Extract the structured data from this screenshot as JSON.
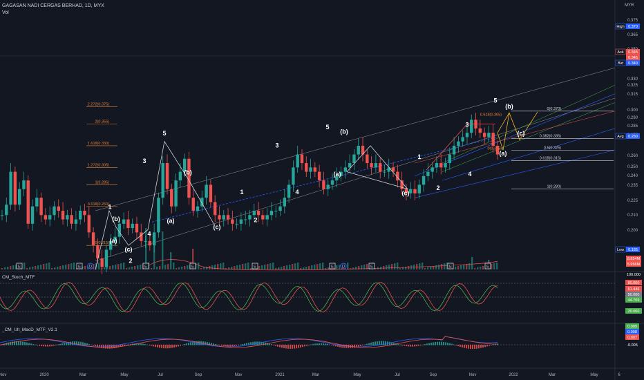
{
  "header": {
    "title": "GAGASAN NADI CERGAS BERHAD, 1D, MYX",
    "vol_label": "Vol",
    "corner_label": "MYR"
  },
  "indicators": {
    "stoch": {
      "name": "CM_Stoch_MTF",
      "levels": [
        "100.000",
        "80.000",
        "61.446",
        "50.000",
        "44.709",
        "20.000"
      ],
      "colors": [
        "#ef5350",
        "#4caf50"
      ]
    },
    "macd": {
      "name": "_CM_Ult_MacD_MTF_V2.1",
      "levels": [
        "0.009",
        "0.008",
        "0.007",
        "-0.005"
      ]
    }
  },
  "price_axis": {
    "ticks": [
      "0.375",
      "0.365",
      "0.350",
      "0.340",
      "0.330",
      "0.325",
      "0.315",
      "0.300",
      "0.290",
      "0.285",
      "0.275",
      "0.260",
      "0.250",
      "0.240",
      "0.235",
      "0.225",
      "0.210",
      "0.200"
    ],
    "badges": [
      {
        "label": "High",
        "value": "0.370",
        "color": "#2962ff"
      },
      {
        "label": "Ask",
        "value": "0.345",
        "color": "#ef5350"
      },
      {
        "label": "",
        "value": "0.345",
        "color": "#ef5350"
      },
      {
        "label": "Bid",
        "value": "0.340",
        "color": "#2962ff"
      },
      {
        "label": "Avg",
        "value": "0.280",
        "color": "#2962ff"
      },
      {
        "label": "Low",
        "value": "0.185",
        "color": "#2962ff"
      }
    ],
    "vol_badges": [
      {
        "value": "8.854M",
        "color": "#ef5350"
      },
      {
        "value": "5.956M",
        "color": "#ef5350"
      }
    ]
  },
  "time_axis": [
    "Nov",
    "2020",
    "Mar",
    "May",
    "Jul",
    "Sep",
    "Nov",
    "2021",
    "Mar",
    "May",
    "Jul",
    "Sep",
    "Nov",
    "2022",
    "Mar",
    "May",
    "6"
  ],
  "fib_left": [
    {
      "label": "2.272(0.375)",
      "price": 0.375
    },
    {
      "label": "2(0.355)",
      "price": 0.355
    },
    {
      "label": "1.618(0.330)",
      "price": 0.33
    },
    {
      "label": "1.272(0.305)",
      "price": 0.305
    },
    {
      "label": "1(0.285)",
      "price": 0.285
    },
    {
      "label": "0.618(0.260)",
      "price": 0.26
    },
    {
      "label": "0(0.215)",
      "price": 0.215
    }
  ],
  "fib_right": [
    {
      "label": "0(0.370)",
      "price": 0.37
    },
    {
      "label": "0.382(0.335)",
      "price": 0.3385
    },
    {
      "label": "0.5(0.325)",
      "price": 0.325
    },
    {
      "label": "0.618(0.315)",
      "price": 0.313
    },
    {
      "label": "1(0.280)",
      "price": 0.28
    }
  ],
  "fib_small": [
    {
      "label": "0.618(0.365)",
      "price": 0.364
    },
    {
      "label": "0(0.325)",
      "price": 0.325
    }
  ],
  "wave_labels": [
    {
      "text": "1",
      "x": 159,
      "price": 0.257
    },
    {
      "text": "(b)",
      "x": 168,
      "price": 0.243
    },
    {
      "text": "(a)",
      "x": 164,
      "price": 0.218
    },
    {
      "text": "(c)",
      "x": 186,
      "price": 0.208
    },
    {
      "text": "2",
      "x": 189,
      "price": 0.195
    },
    {
      "text": "3",
      "x": 209,
      "price": 0.31
    },
    {
      "text": "4",
      "x": 216,
      "price": 0.226
    },
    {
      "text": "5",
      "x": 238,
      "price": 0.342
    },
    {
      "text": "(b)",
      "x": 272,
      "price": 0.297
    },
    {
      "text": "(a)",
      "x": 247,
      "price": 0.241
    },
    {
      "text": "(c)",
      "x": 314,
      "price": 0.234
    },
    {
      "text": "1",
      "x": 350,
      "price": 0.274
    },
    {
      "text": "2",
      "x": 370,
      "price": 0.242
    },
    {
      "text": "3",
      "x": 401,
      "price": 0.328
    },
    {
      "text": "4",
      "x": 430,
      "price": 0.274
    },
    {
      "text": "5",
      "x": 474,
      "price": 0.349
    },
    {
      "text": "(b)",
      "x": 498,
      "price": 0.344
    },
    {
      "text": "(a)",
      "x": 488,
      "price": 0.295
    },
    {
      "text": "(c)",
      "x": 587,
      "price": 0.273
    },
    {
      "text": "1",
      "x": 607,
      "price": 0.315
    },
    {
      "text": "2",
      "x": 634,
      "price": 0.279
    },
    {
      "text": "3",
      "x": 676,
      "price": 0.352
    },
    {
      "text": "4",
      "x": 680,
      "price": 0.295
    },
    {
      "text": "5",
      "x": 717,
      "price": 0.38
    },
    {
      "text": "(b)",
      "x": 737,
      "price": 0.373
    },
    {
      "text": "(c)",
      "x": 754,
      "price": 0.342
    },
    {
      "text": "(a)",
      "x": 728,
      "price": 0.319
    }
  ],
  "earnings_markers": [
    "E",
    "E",
    "D",
    "E",
    "E",
    "E",
    "E",
    "D",
    "E",
    "E",
    "E"
  ],
  "chart_data": {
    "type": "candlestick",
    "ylim": [
      0.185,
      0.38
    ],
    "close": [
      0.25,
      0.262,
      0.3,
      0.262,
      0.28,
      0.29,
      0.24,
      0.26,
      0.27,
      0.25,
      0.245,
      0.25,
      0.26,
      0.255,
      0.245,
      0.25,
      0.24,
      0.245,
      0.255,
      0.25,
      0.23,
      0.215,
      0.2,
      0.19,
      0.21,
      0.22,
      0.225,
      0.24,
      0.245,
      0.235,
      0.24,
      0.23,
      0.22,
      0.22,
      0.215,
      0.23,
      0.27,
      0.31,
      0.28,
      0.26,
      0.29,
      0.3,
      0.315,
      0.27,
      0.255,
      0.26,
      0.27,
      0.285,
      0.265,
      0.25,
      0.245,
      0.25,
      0.245,
      0.24,
      0.24,
      0.245,
      0.245,
      0.25,
      0.255,
      0.25,
      0.245,
      0.25,
      0.255,
      0.255,
      0.26,
      0.27,
      0.285,
      0.305,
      0.32,
      0.31,
      0.3,
      0.305,
      0.3,
      0.29,
      0.28,
      0.285,
      0.29,
      0.295,
      0.3,
      0.305,
      0.31,
      0.32,
      0.33,
      0.32,
      0.31,
      0.305,
      0.31,
      0.3,
      0.3,
      0.305,
      0.3,
      0.29,
      0.28,
      0.275,
      0.28,
      0.275,
      0.285,
      0.295,
      0.3,
      0.305,
      0.31,
      0.305,
      0.31,
      0.32,
      0.33,
      0.335,
      0.34,
      0.345,
      0.36,
      0.35,
      0.345,
      0.34,
      0.345,
      0.33,
      0.32
    ]
  }
}
